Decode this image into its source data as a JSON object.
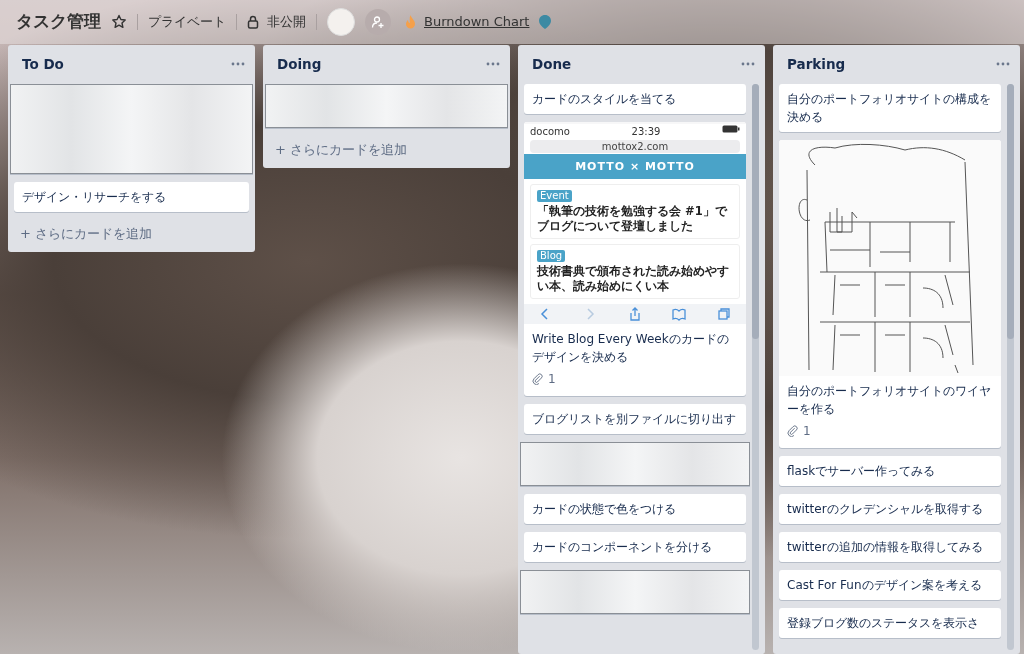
{
  "board": {
    "title": "タスク管理",
    "starred": false,
    "team": "プライベート",
    "visibility": "非公開",
    "powerup": "Burndown Chart"
  },
  "lists": [
    {
      "title": "To Do",
      "scroll": false,
      "add_card": "+ さらにカードを追加",
      "cards": [
        {
          "kind": "blurred"
        },
        {
          "kind": "text",
          "title": "デザイン・リサーチをする"
        }
      ]
    },
    {
      "title": "Doing",
      "scroll": false,
      "add_card": "+ さらにカードを追加",
      "cards": [
        {
          "kind": "blurred"
        }
      ]
    },
    {
      "title": "Done",
      "scroll": true,
      "cards": [
        {
          "kind": "text",
          "title": "カードのスタイルを当てる"
        },
        {
          "kind": "phone",
          "title": "Write Blog Every Weekのカードのデザインを決める",
          "attachments": "1",
          "phone": {
            "carrier": "docomo",
            "time": "23:39",
            "url": "mottox2.com",
            "site": "MOTTO × MOTTO",
            "posts": [
              {
                "tag": "Event",
                "headline": "「執筆の技術を勉強する会 #1」でブログについて登壇しました"
              },
              {
                "tag": "Blog",
                "headline": "技術書典で頒布された読み始めやすい本、読み始めにくい本"
              }
            ]
          }
        },
        {
          "kind": "text",
          "title": "ブログリストを別ファイルに切り出す"
        },
        {
          "kind": "blurred"
        },
        {
          "kind": "text",
          "title": "カードの状態で色をつける"
        },
        {
          "kind": "text",
          "title": "カードのコンポーネントを分ける"
        },
        {
          "kind": "blurred"
        }
      ]
    },
    {
      "title": "Parking",
      "scroll": true,
      "cards": [
        {
          "kind": "text",
          "title": "自分のポートフォリオサイトの構成を決める"
        },
        {
          "kind": "sketch",
          "title": "自分のポートフォリオサイトのワイヤーを作る",
          "attachments": "1"
        },
        {
          "kind": "text",
          "title": "flaskでサーバー作ってみる"
        },
        {
          "kind": "text",
          "title": "twitterのクレデンシャルを取得する"
        },
        {
          "kind": "text",
          "title": "twitterの追加の情報を取得してみる"
        },
        {
          "kind": "text",
          "title": "Cast For Funのデザイン案を考える"
        },
        {
          "kind": "text",
          "title": "登録ブログ数のステータスを表示さ"
        }
      ]
    }
  ]
}
